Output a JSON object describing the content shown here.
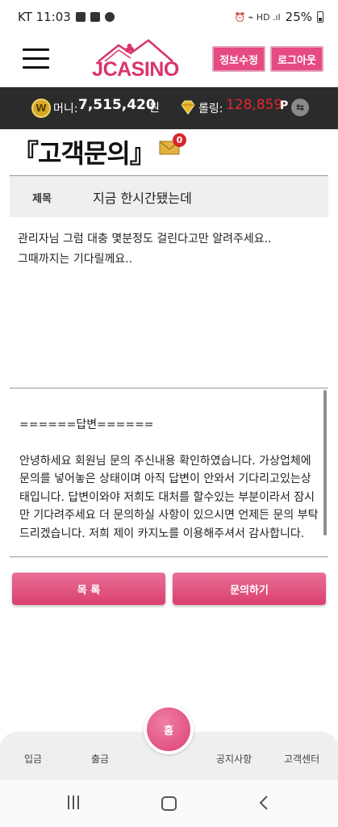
{
  "status_bar": {
    "carrier_time": "KT 11:03",
    "right_icons": "⏰ ⌁ HD .ıl",
    "battery": "25%"
  },
  "header": {
    "logo_text": "JCASINO",
    "edit_button": "정보수정",
    "logout_button": "로그아웃"
  },
  "balance": {
    "coin_icon": "W",
    "money_label": "머니:",
    "money_value": "7,515,420",
    "money_unit": "원",
    "point_label": "롤링:",
    "point_value": "128,859",
    "point_unit": "P",
    "exchange_icon": "⇆"
  },
  "page": {
    "title": "『고객문의』",
    "mail_badge": "0"
  },
  "inquiry": {
    "subject_label": "제목",
    "subject_value": "지금 한시간됐는데",
    "question": "관리자님 그럼 대충 몇분정도 걸린다고만 알려주세요.. 그때까지는 기다릴께요..",
    "answer_header": "======답변======",
    "answer_body": "안녕하세요 회원님 문의 주신내용 확인하였습니다. 가상업체에 문의를 넣어놓은 상태이며 아직 답변이 안와서 기다리고있는상태입니다. 답변이와야 저희도 대처를 할수있는 부분이라서 잠시만 기다려주세요 더 문의하실 사항이 있으시면 언제든 문의 부탁드리겠습니다. 저희 제이 카지노를 이용해주셔서 감사합니다."
  },
  "actions": {
    "list_button": "목 록",
    "inquiry_button": "문의하기"
  },
  "bottom_nav": {
    "deposit": "입금",
    "withdraw": "출금",
    "home": "홈",
    "notice": "공지사항",
    "support": "고객센터"
  },
  "colors": {
    "brand_pink": "#e54a82",
    "dark_bar": "#2b2b2b",
    "point_red": "#e5252c"
  }
}
